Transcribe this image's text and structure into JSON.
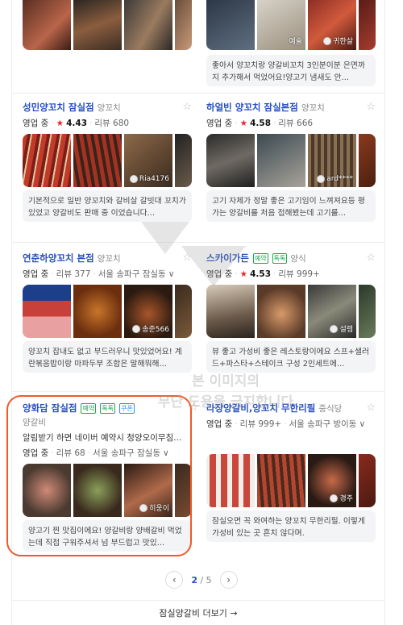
{
  "top_left": {
    "images": [
      "steak",
      "grill",
      "skewers",
      "bbq"
    ]
  },
  "top_right": {
    "tags": [
      "예술",
      "귀한살"
    ],
    "review": "좋아서 양꼬치랑 양갈비꼬치 3인분이분 은면까지 추가해서 먹었어요!양고기 냄새도 안..."
  },
  "places": [
    {
      "name": "성민양꼬치 잠실점",
      "category": "양꼬치",
      "status": "영업 중",
      "rating": "4.43",
      "reviews": "리뷰 680",
      "photo_tag": "Ria4176",
      "review": "기본적으로 일반 양꼬치와 갈비살 갈빗대 꼬치가있었고 양갈비도 판매 중 이었습니다..."
    },
    {
      "name": "하얼빈 양꼬치 잠실본점",
      "category": "양꼬치",
      "status": "영업 중",
      "rating": "4.58",
      "reviews": "리뷰 666",
      "photo_tag": "ard****",
      "review": "고기 자체가 정말 좋은 고기임이 느껴져요등 평가는 양갈비를 처음 접해봤는데 고기를..."
    },
    {
      "name": "연춘하양꼬치 본점",
      "category": "양꼬치",
      "status": "영업 중",
      "reviews": "리뷰 377",
      "location": "서울 송파구 잠실동",
      "photo_tag": "송준566",
      "review": "양꼬치 잡내도 없고 부드러우니 맛있었어요! 계란볶음밥이랑 마파두부 조합은 말해뭐해..."
    },
    {
      "name": "스카이가든",
      "category": "양식",
      "status": "영업 중",
      "rating": "4.53",
      "reviews": "리뷰 999+",
      "photo_tag": "설렘",
      "review": "뷰 좋고 가성비 좋은 레스토랑이에요 스프+샐러드+파스타+스테이크 구성 2인세트에..."
    },
    {
      "name": "양화담 잠실점",
      "category": "양갈비",
      "badges": [
        "예약",
        "톡톡",
        "쿠폰"
      ],
      "desc": "알림받기 하면 네이버 예약시 청양오이무침...",
      "status": "영업 중",
      "reviews": "리뷰 68",
      "location": "서울 송파구 잠실동",
      "photo_tag": "히웅이",
      "review": "양고기 찐 맛집이에요! 양갈비랑 양배갈비 먹었는데 직접 구워주셔서 넘 부드럽고 맛있..."
    },
    {
      "name": "라장양갈비,양꼬치 무한리필",
      "category": "중식당",
      "status": "영업 중",
      "reviews": "리뷰 999+",
      "location": "서울 송파구 방이동",
      "photo_tag": "경주",
      "review": "잠실오면 꼭 와여하는 양꼬치 무한리필. 이렇게 가성비 있는 곳 흔치 않다며."
    }
  ],
  "pagination": {
    "current": "2",
    "total": "5"
  },
  "more_label": "잠실양갈비 더보기 →",
  "watermark": {
    "line1": "본 이미지의",
    "line2": "무단 도용을 금지합니다"
  },
  "colors": {
    "link": "#2750c2",
    "highlight": "#f05a28",
    "star": "#e8262c"
  }
}
